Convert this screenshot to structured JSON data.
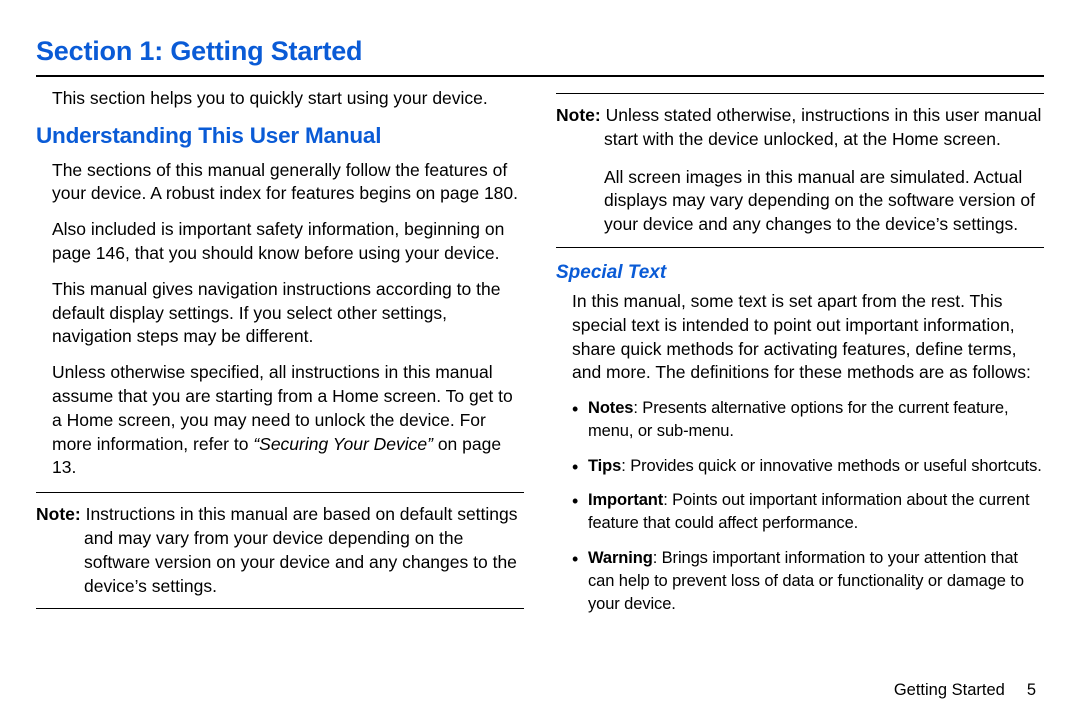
{
  "section_title": "Section 1: Getting Started",
  "intro": "This section helps you to quickly start using your device.",
  "h2_understanding": "Understanding This User Manual",
  "left": {
    "p1": "The sections of this manual generally follow the features of your device. A robust index for features begins on page 180.",
    "p2": "Also included is important safety information, beginning on page 146, that you should know before using your device.",
    "p3": "This manual gives navigation instructions according to the default display settings. If you select other settings, navigation steps may be different.",
    "p4a": "Unless otherwise specified, all instructions in this manual assume that you are starting from a Home screen. To get to a Home screen, you may need to unlock the device. For more information, refer to ",
    "p4_ref": "“Securing Your Device”",
    "p4b": "  on page 13.",
    "note1_label": "Note:",
    "note1_text": " Instructions in this manual are based on default settings and may vary from your device depending on the software version on your device and any changes to the device’s settings."
  },
  "right": {
    "note2a_label": "Note:",
    "note2a_text": " Unless stated otherwise, instructions in this user manual start with the device unlocked, at the Home screen.",
    "note2b": "All screen images in this manual are simulated. Actual displays may vary depending on the software version of your device and any changes to the device’s settings.",
    "h3_special": "Special Text",
    "special_intro": "In this manual, some text is set apart from the rest. This special text is intended to point out important information, share quick methods for activating features, define terms, and more. The definitions for these methods are as follows:",
    "bullets": [
      {
        "k": "Notes",
        "t": ": Presents alternative options for the current feature, menu, or sub-menu."
      },
      {
        "k": "Tips",
        "t": ": Provides quick or innovative methods or useful shortcuts."
      },
      {
        "k": "Important",
        "t": ": Points out important information about the current feature that could affect performance."
      },
      {
        "k": "Warning",
        "t": ": Brings important information to your attention that can help to prevent loss of data or functionality or damage to your device."
      }
    ]
  },
  "footer": {
    "label": "Getting Started",
    "page": "5"
  }
}
